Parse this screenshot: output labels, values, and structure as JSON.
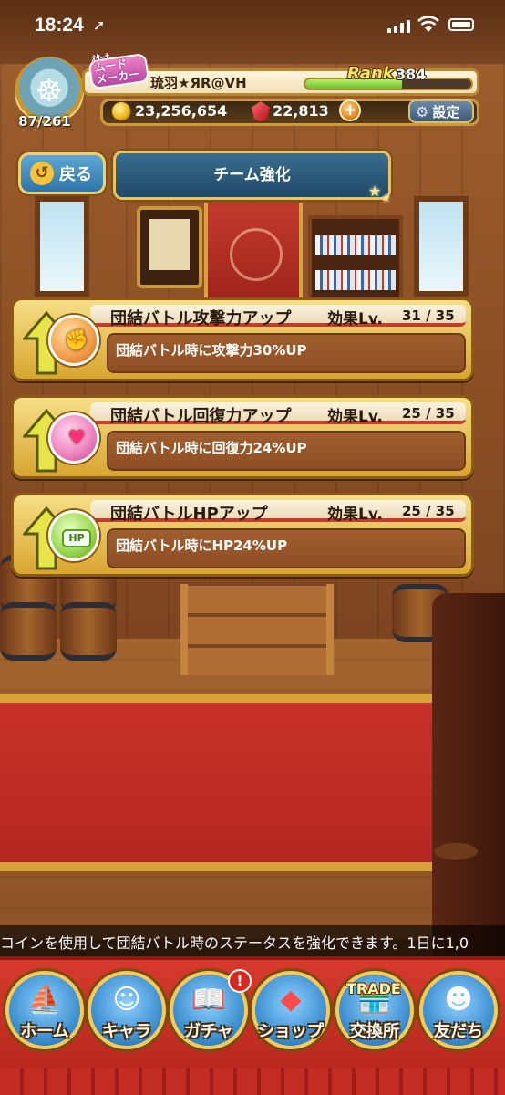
{
  "statusbar": {
    "time": "18:24",
    "location_icon": "location-arrow-icon",
    "signal_icon": "cellular-signal-icon",
    "wifi_icon": "wifi-icon",
    "battery_icon": "battery-icon"
  },
  "player": {
    "level_progress": "87/261",
    "title_badge_small": "ｵﾀｰﾅ",
    "title_badge_main": "ムード\nメーカー",
    "name": "琉羽★ЯR@VH",
    "rank_label": "Rank",
    "rank_value": "384",
    "exp_fraction": 0.58,
    "coins": "23,256,654",
    "gems": "22,813",
    "plus_label": "+",
    "settings_label": "設定"
  },
  "nav": {
    "back_label": "戻る",
    "page_title": "チーム強化"
  },
  "upgrades": [
    {
      "title": "団結バトル攻撃力アップ",
      "level_label": "効果Lv.",
      "level": "31 / 35",
      "description": "団結バトル時に攻撃力30%UP",
      "icon": "attack-up-icon"
    },
    {
      "title": "団結バトル回復力アップ",
      "level_label": "効果Lv.",
      "level": "25 / 35",
      "description": "団結バトル時に回復力24%UP",
      "icon": "heal-up-icon"
    },
    {
      "title": "団結バトルHPアップ",
      "level_label": "効果Lv.",
      "level": "25 / 35",
      "description": "団結バトル時にHP24%UP",
      "icon": "hp-up-icon",
      "hp_tag": "HP"
    }
  ],
  "ticker": {
    "text": "コインを使用して団結バトル時のステータスを強化できます。1日に1,0"
  },
  "bottom_nav": {
    "home": "ホーム",
    "chara": "キャラ",
    "gacha": "ガチャ",
    "shop": "ショップ",
    "trade": "交換所",
    "trade_banner": "TRADE",
    "friends": "友だち",
    "gacha_alert": "!"
  },
  "colors": {
    "accent_gold": "#e8c264",
    "nav_red": "#c22c22",
    "card_band_red": "#c23b2c",
    "panel_blue": "#2e74a8"
  }
}
